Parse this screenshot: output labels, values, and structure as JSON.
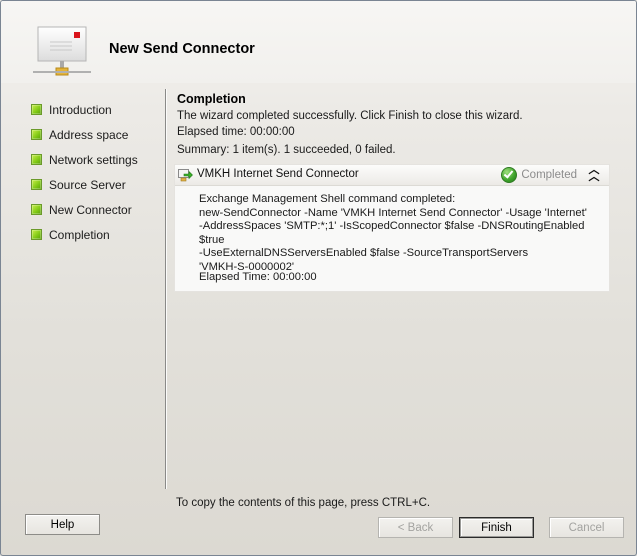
{
  "window": {
    "title": "New Send Connector",
    "header_icon": "mail-connector-icon"
  },
  "nav": {
    "items": [
      {
        "label": "Introduction",
        "status": "complete"
      },
      {
        "label": "Address space",
        "status": "complete"
      },
      {
        "label": "Network settings",
        "status": "complete"
      },
      {
        "label": "Source Server",
        "status": "complete"
      },
      {
        "label": "New Connector",
        "status": "complete"
      },
      {
        "label": "Completion",
        "status": "complete"
      }
    ]
  },
  "content": {
    "title": "Completion",
    "message": "The wizard completed successfully. Click Finish to close this wizard.",
    "elapsed": "Elapsed time: 00:00:00",
    "summary": "Summary: 1 item(s). 1 succeeded, 0 failed."
  },
  "result": {
    "name": "VMKH Internet Send Connector",
    "status": "Completed",
    "status_color": "#3da22a",
    "body": "Exchange Management Shell command completed:\nnew-SendConnector -Name 'VMKH Internet Send Connector' -Usage 'Internet'\n-AddressSpaces 'SMTP:*;1' -IsScopedConnector $false -DNSRoutingEnabled $true\n-UseExternalDNSServersEnabled $false -SourceTransportServers\n'VMKH-S-0000002'",
    "elapsed": "Elapsed Time: 00:00:00"
  },
  "footer": {
    "copy_hint": "To copy the contents of this page, press CTRL+C.",
    "help_label": "Help",
    "back_label": "< Back",
    "finish_label": "Finish",
    "cancel_label": "Cancel"
  }
}
